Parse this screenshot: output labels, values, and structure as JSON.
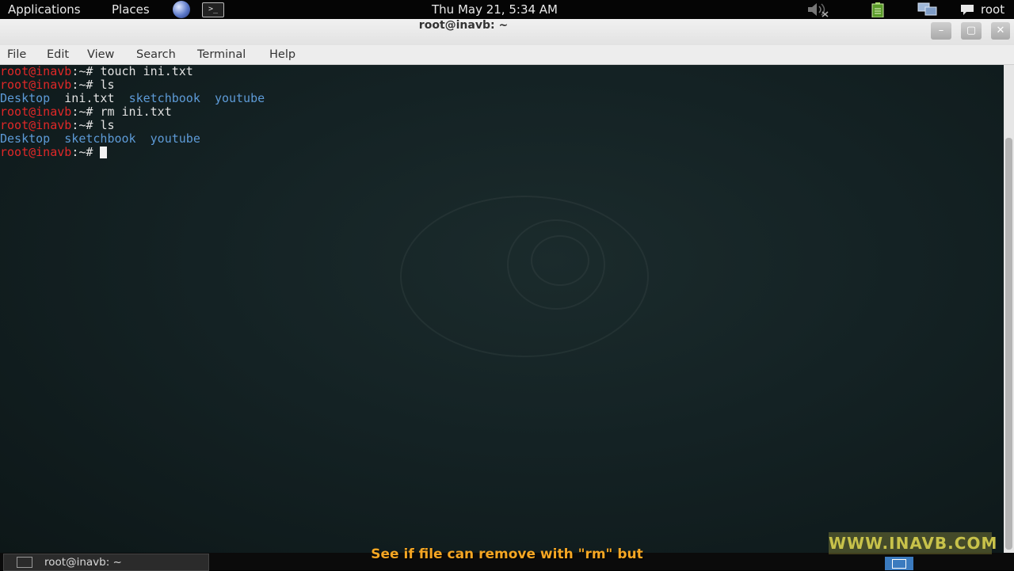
{
  "top_panel": {
    "applications": "Applications",
    "places": "Places",
    "clock": "Thu May 21,  5:34 AM",
    "user": "root"
  },
  "window": {
    "title": "root@inavb: ~",
    "minimize": "–",
    "maximize": "▢",
    "close": "✕"
  },
  "menu": [
    "File",
    "Edit",
    "View",
    "Search",
    "Terminal",
    "Help"
  ],
  "terminal": {
    "prompt_user": "root@inavb",
    "prompt_path": ":~# ",
    "lines": [
      {
        "type": "cmd",
        "text": "touch ini.txt"
      },
      {
        "type": "cmd",
        "text": "ls"
      },
      {
        "type": "out",
        "items": [
          "Desktop",
          "ini.txt",
          "sketchbook",
          "youtube"
        ]
      },
      {
        "type": "cmd",
        "text": "rm ini.txt"
      },
      {
        "type": "cmd",
        "text": "ls"
      },
      {
        "type": "out",
        "items": [
          "Desktop",
          "sketchbook",
          "youtube"
        ]
      },
      {
        "type": "cmd",
        "text": ""
      }
    ],
    "dir_color": "#5d9ad6",
    "prompt_color": "#e02828"
  },
  "taskbar": {
    "item_label": "root@inavb: ~"
  },
  "subtitle": "See if file can remove with \"rm\" but",
  "watermark": "WWW.INAVB.COM"
}
